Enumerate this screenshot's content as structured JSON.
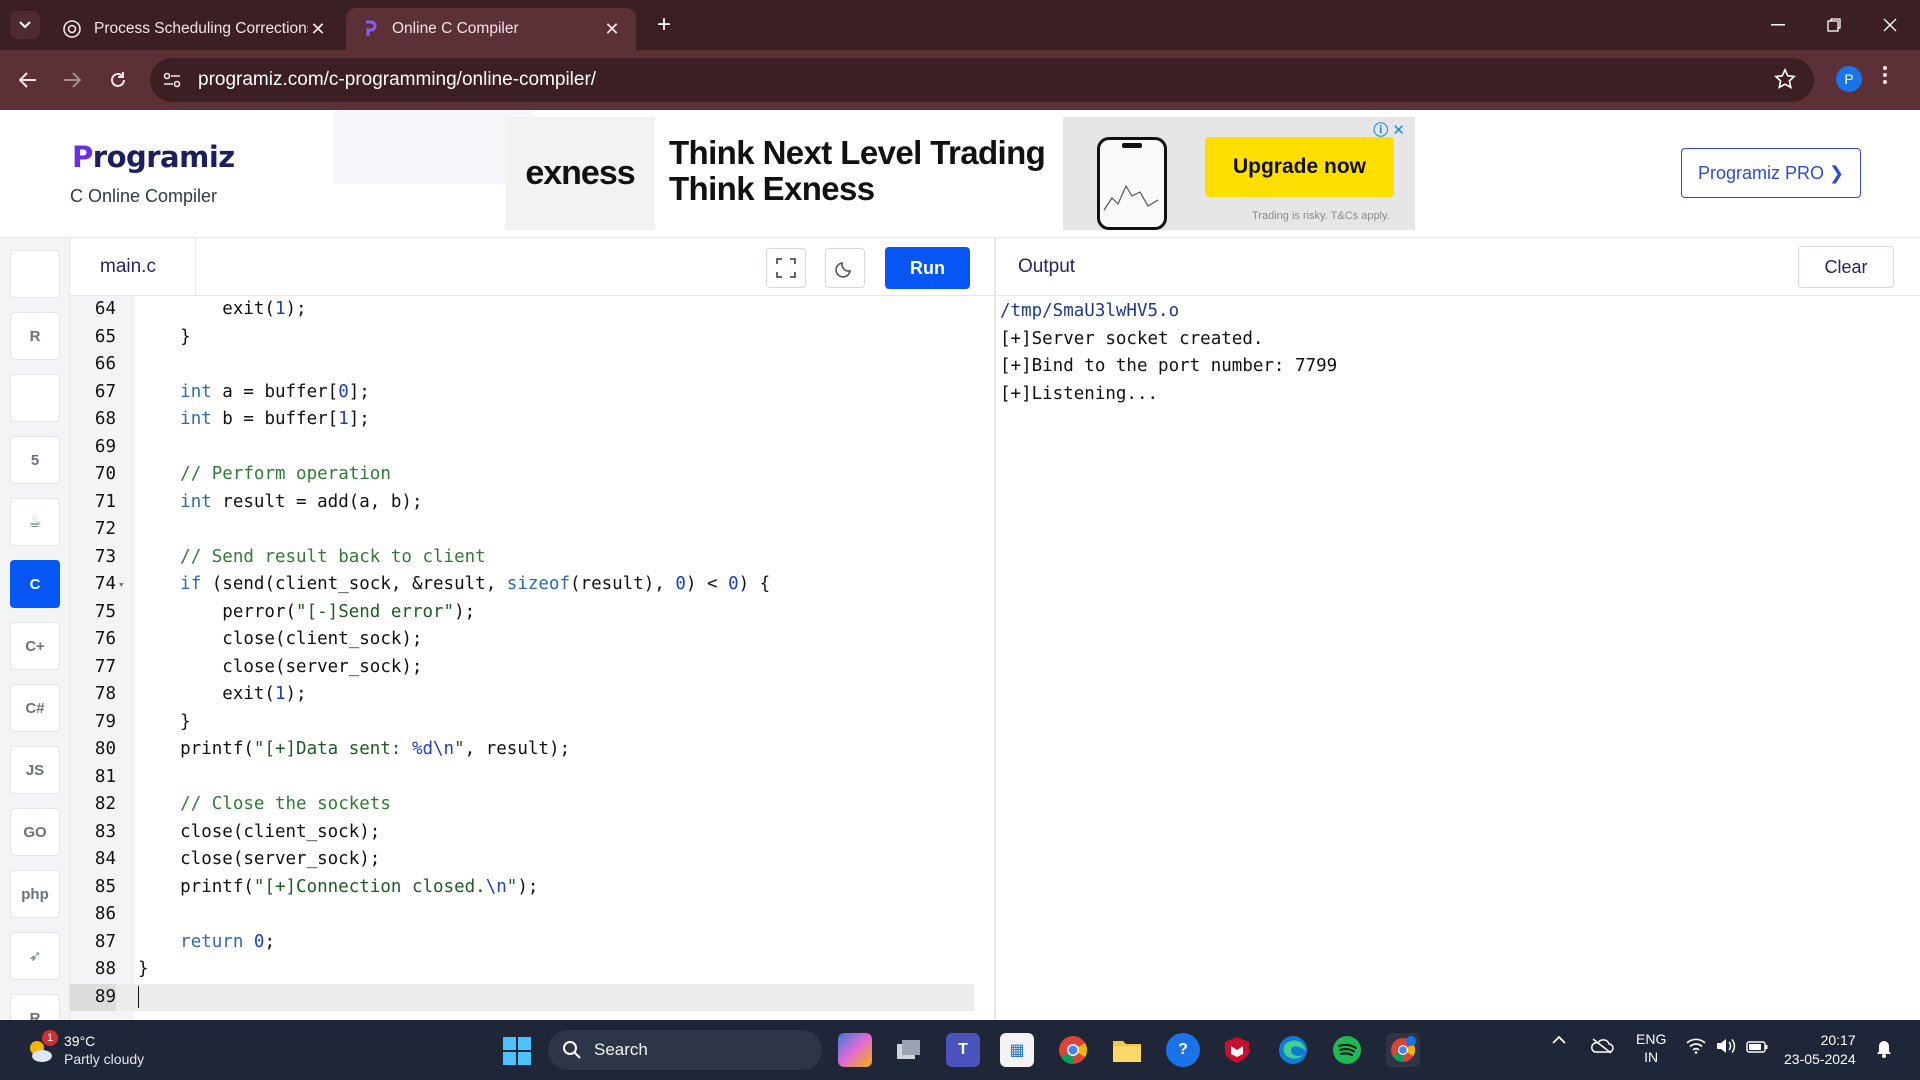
{
  "browser": {
    "tabs": [
      {
        "title": "Process Scheduling Corrections",
        "favicon": "chatgpt-icon",
        "active": false
      },
      {
        "title": "Online C Compiler",
        "favicon": "programiz-icon",
        "active": true
      }
    ],
    "url": "programiz.com/c-programming/online-compiler/",
    "profile_initial": "P"
  },
  "header": {
    "logo_text": "rogramiz",
    "logo_initial": "P",
    "subtitle": "C Online Compiler",
    "pro_button": "Programiz PRO ❯"
  },
  "ad": {
    "brand": "exness",
    "headline_line1": "Think Next Level Trading",
    "headline_line2": "Think Exness",
    "cta": "Upgrade now",
    "disclaimer": "Trading is risky. T&Cs apply."
  },
  "languages": [
    {
      "name": "python-icon",
      "label": ""
    },
    {
      "name": "r-icon",
      "label": "R"
    },
    {
      "name": "sql-icon",
      "label": ""
    },
    {
      "name": "html-icon",
      "label": "5"
    },
    {
      "name": "java-icon",
      "label": "☕"
    },
    {
      "name": "c-icon",
      "label": "C",
      "active": true
    },
    {
      "name": "cpp-icon",
      "label": "C+"
    },
    {
      "name": "csharp-icon",
      "label": "C#"
    },
    {
      "name": "js-icon",
      "label": "JS"
    },
    {
      "name": "go-icon",
      "label": "GO"
    },
    {
      "name": "php-icon",
      "label": "php"
    },
    {
      "name": "swift-icon",
      "label": "➶"
    },
    {
      "name": "rust-icon",
      "label": "R"
    }
  ],
  "editor": {
    "filename": "main.c",
    "run_label": "Run",
    "lines": [
      {
        "n": "64",
        "html": "        exit(<span class=\"nm\">1</span>);"
      },
      {
        "n": "65",
        "html": "    }"
      },
      {
        "n": "66",
        "html": ""
      },
      {
        "n": "67",
        "html": "    <span class=\"kw\">int</span> a = buffer[<span class=\"nm\">0</span>];"
      },
      {
        "n": "68",
        "html": "    <span class=\"kw\">int</span> b = buffer[<span class=\"nm\">1</span>];"
      },
      {
        "n": "69",
        "html": ""
      },
      {
        "n": "70",
        "html": "    <span class=\"cm\">// Perform operation</span>"
      },
      {
        "n": "71",
        "html": "    <span class=\"kw\">int</span> result = add(a, b);"
      },
      {
        "n": "72",
        "html": ""
      },
      {
        "n": "73",
        "html": "    <span class=\"cm\">// Send result back to client</span>"
      },
      {
        "n": "74",
        "fold": true,
        "html": "    <span class=\"kw\">if</span> (send(client_sock, &amp;result, <span class=\"kw\">sizeof</span>(result), <span class=\"nm\">0</span>) &lt; <span class=\"nm\">0</span>) {"
      },
      {
        "n": "75",
        "html": "        perror(<span class=\"st\">\"[-]Send error\"</span>);"
      },
      {
        "n": "76",
        "html": "        close(client_sock);"
      },
      {
        "n": "77",
        "html": "        close(server_sock);"
      },
      {
        "n": "78",
        "html": "        exit(<span class=\"nm\">1</span>);"
      },
      {
        "n": "79",
        "html": "    }"
      },
      {
        "n": "80",
        "html": "    printf(<span class=\"st\">\"[+]Data sent: </span><span class=\"esc\">%d\\n</span><span class=\"st\">\"</span>, result);"
      },
      {
        "n": "81",
        "html": ""
      },
      {
        "n": "82",
        "html": "    <span class=\"cm\">// Close the sockets</span>"
      },
      {
        "n": "83",
        "html": "    close(client_sock);"
      },
      {
        "n": "84",
        "html": "    close(server_sock);"
      },
      {
        "n": "85",
        "html": "    printf(<span class=\"st\">\"[+]Connection closed.</span><span class=\"esc\">\\n</span><span class=\"st\">\"</span>);"
      },
      {
        "n": "86",
        "html": ""
      },
      {
        "n": "87",
        "html": "    <span class=\"kw\">return</span> <span class=\"nm\">0</span>;"
      },
      {
        "n": "88",
        "html": "}"
      },
      {
        "n": "89",
        "html": "<span class=\"cursor\"></span>",
        "current": true
      }
    ]
  },
  "output": {
    "title": "Output",
    "clear_label": "Clear",
    "lines": [
      "/tmp/SmaU3lwHV5.o",
      "[+]Server socket created.",
      "[+]Bind to the port number: 7799",
      "[+]Listening..."
    ]
  },
  "taskbar": {
    "weather_temp": "39°C",
    "weather_desc": "Partly cloudy",
    "weather_badge": "1",
    "search_label": "Search",
    "lang_line1": "ENG",
    "lang_line2": "IN",
    "time": "20:17",
    "date": "23-05-2024"
  },
  "colors": {
    "accent": "#0556f3",
    "chrome_dark": "#3c1f24",
    "chrome_mid": "#5c3037"
  }
}
